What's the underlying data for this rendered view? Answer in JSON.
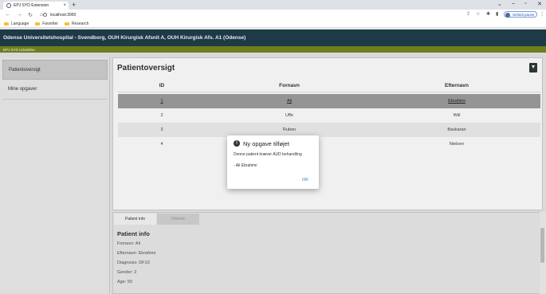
{
  "browser": {
    "tab_title": "EPJ SYD Extension",
    "tab_close": "×",
    "new_tab": "+",
    "url": "localhost:3000",
    "profile_label": "Sefuldi pause",
    "bookmarks": [
      "Language",
      "Favoriter",
      "Research"
    ]
  },
  "app": {
    "title": "Odense Universitetshospital - Svendborg, OUH Kirurgisk Afsnit A, OUH Kirurgisk Afs. A1 (Odense)",
    "subtitle": "EPJ SYD Udvidelse"
  },
  "sidebar": {
    "items": [
      {
        "label": "Patientoversigt"
      },
      {
        "label": "Mine opgaver"
      }
    ]
  },
  "main": {
    "title": "Patientoversigt",
    "columns": [
      "ID",
      "Fornavn",
      "Efternavn"
    ],
    "rows": [
      [
        "1",
        "Ali",
        "Ebrahimi"
      ],
      [
        "2",
        "Uffe",
        "Wiil"
      ],
      [
        "3",
        "Ruben",
        "Baskaran"
      ],
      [
        "4",
        "",
        "Nielsen"
      ]
    ]
  },
  "lower": {
    "tabs": [
      "Patient info",
      "Historik"
    ],
    "info_title": "Patient info",
    "fields": [
      "Fornavn: Ali",
      "Efternavn: Ebrahimi",
      "Diagnosis: DF10",
      "Gender: 2",
      "Age: 50"
    ]
  },
  "dialog": {
    "icon": "!",
    "title": "Ny opgave tilføjet",
    "message": "Denne patient kræver AUD behandling",
    "detail": "- Ali Ebrahimi",
    "ok_label": "OK"
  }
}
